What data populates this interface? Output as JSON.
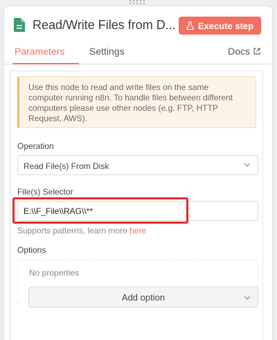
{
  "header": {
    "title": "Read/Write Files from D...",
    "execute_label": "Execute step"
  },
  "tabs": [
    {
      "label": "Parameters",
      "active": true
    },
    {
      "label": "Settings",
      "active": false
    },
    {
      "label": "Docs",
      "active": false
    }
  ],
  "notice": {
    "line1": "Use this node to read and write files on the same",
    "line2": "computer running n8n. To handle files between different",
    "line3": "computers please use other nodes (e.g. FTP, HTTP",
    "line4": "Request, AWS)."
  },
  "operation": {
    "label": "Operation",
    "value": "Read File(s) From Disk"
  },
  "file_selector": {
    "label": "File(s) Selector",
    "value": "E:\\\\F_File\\\\RAG\\\\**",
    "hint_prefix": "Supports patterns, learn more ",
    "hint_link": "here"
  },
  "options": {
    "label": "Options",
    "empty_text": "No properties",
    "add_label": "Add option"
  },
  "colors": {
    "accent": "#f36f60",
    "highlight": "#e42b2b",
    "notice_bg": "#fdf3e6"
  },
  "icons": {
    "node": "file-document-icon",
    "execute": "flask-icon",
    "docs": "external-link-icon",
    "dropdown": "chevron-down-icon"
  }
}
